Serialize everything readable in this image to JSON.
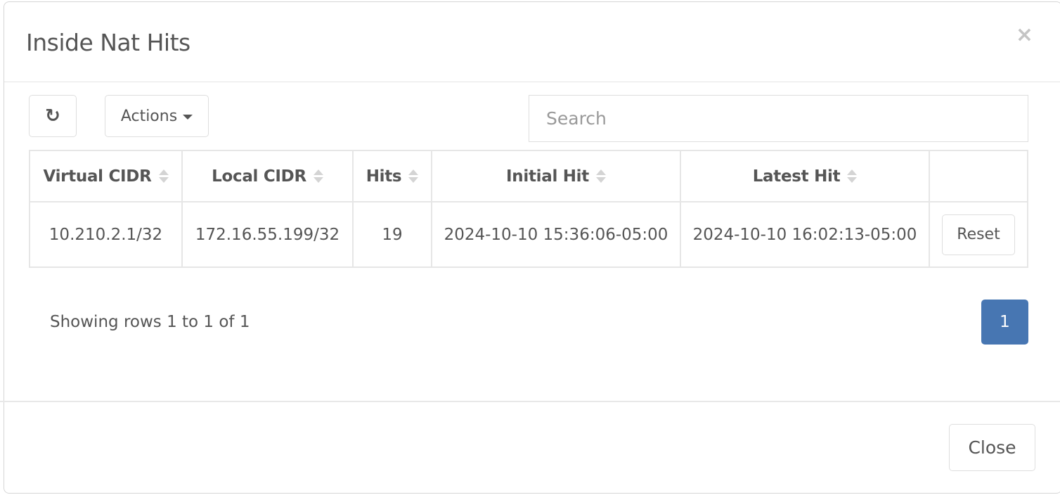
{
  "modal": {
    "title": "Inside Nat Hits",
    "close_icon": "×"
  },
  "toolbar": {
    "refresh_icon": "↻",
    "actions_label": "Actions",
    "search_placeholder": "Search",
    "search_value": ""
  },
  "table": {
    "columns": [
      {
        "label": "Virtual CIDR",
        "sortable": true
      },
      {
        "label": "Local CIDR",
        "sortable": true
      },
      {
        "label": "Hits",
        "sortable": true
      },
      {
        "label": "Initial Hit",
        "sortable": true
      },
      {
        "label": "Latest Hit",
        "sortable": true
      },
      {
        "label": "",
        "sortable": false
      }
    ],
    "rows": [
      {
        "virtual_cidr": "10.210.2.1/32",
        "local_cidr": "172.16.55.199/32",
        "hits": "19",
        "initial_hit": "2024-10-10 15:36:06-05:00",
        "latest_hit": "2024-10-10 16:02:13-05:00",
        "action_label": "Reset"
      }
    ]
  },
  "pagination": {
    "summary": "Showing rows 1 to 1 of 1",
    "pages": [
      "1"
    ],
    "active_page": "1",
    "active_color": "#4776b2"
  },
  "footer": {
    "close_label": "Close"
  }
}
